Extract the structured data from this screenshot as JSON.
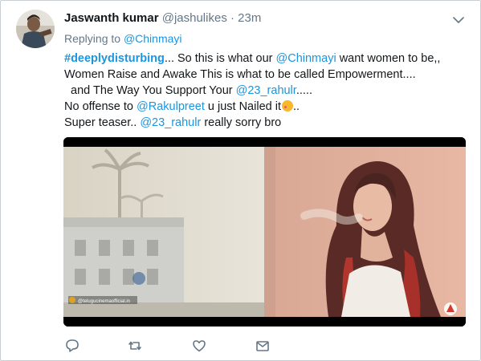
{
  "tweet": {
    "author_name": "Jaswanth kumar",
    "author_handle": "@jashulikes",
    "separator": "·",
    "time": "23m",
    "replying_prefix": "Replying to",
    "replying_to": "@Chinmayi",
    "lines": {
      "l1_hashtag": "#deeplydisturbing",
      "l1_a": "... So this is what our ",
      "l1_mention": "@Chinmayi",
      "l1_b": " want women to be,,",
      "l2": "Women Raise and Awake This is what to be called Empowerment....",
      "l3_a": "  and The Way You Support Your ",
      "l3_mention": "@23_rahulr",
      "l3_b": ".....",
      "l4_a": "No offense to ",
      "l4_mention": "@Rakulpreet",
      "l4_b": " u just Nailed it",
      "l4_c": "..",
      "l5_a": "Super teaser.. ",
      "l5_mention": "@23_rahulr",
      "l5_b": " really sorry bro"
    },
    "media": {
      "watermark": "@telugucinemaofficial.in"
    }
  },
  "icons": {
    "avatar": "avatar-photo",
    "caret": "chevron-down-icon",
    "reply": "reply-icon",
    "retweet": "retweet-icon",
    "like": "heart-icon",
    "dm": "envelope-icon"
  },
  "colors": {
    "link": "#1b95e0",
    "secondary": "#657786",
    "text": "#14171a"
  }
}
